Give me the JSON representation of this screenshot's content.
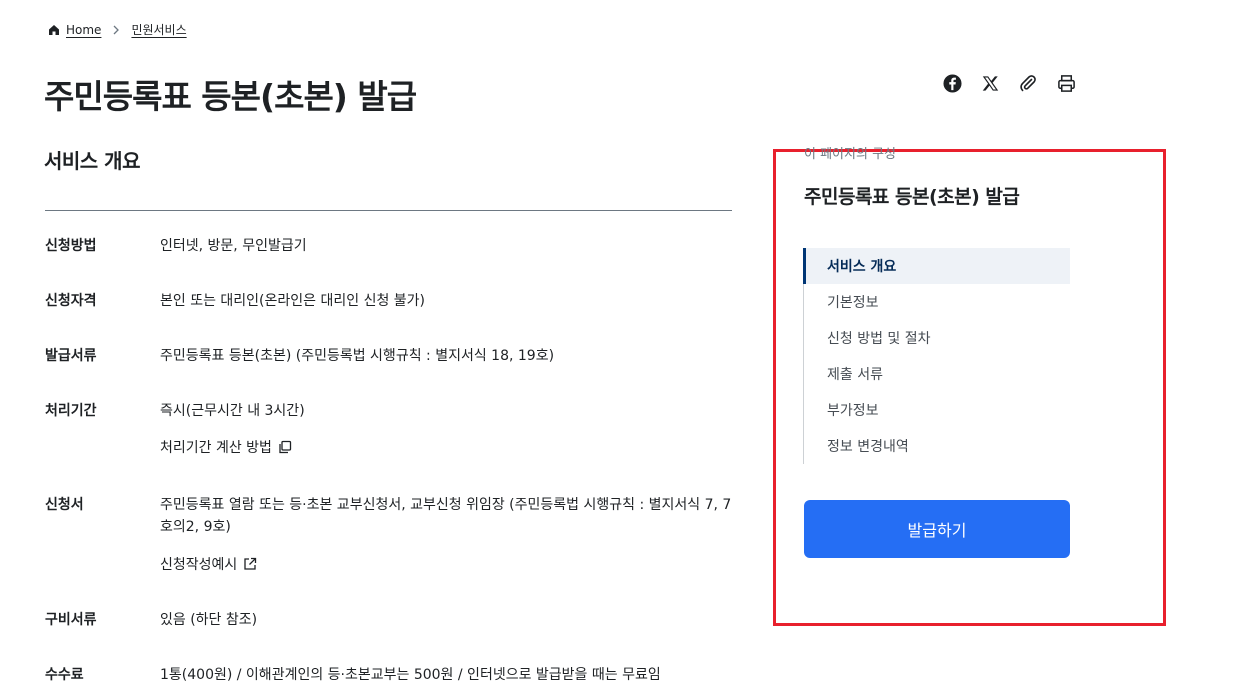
{
  "breadcrumb": {
    "home": "Home",
    "current": "민원서비스"
  },
  "page": {
    "title": "주민등록표 등본(초본) 발급"
  },
  "share": {
    "icons": [
      "facebook-icon",
      "x-icon",
      "link-clip-icon",
      "print-icon"
    ]
  },
  "overview": {
    "title": "서비스 개요",
    "rows": [
      {
        "label": "신청방법",
        "value": "인터넷, 방문, 무인발급기"
      },
      {
        "label": "신청자격",
        "value": "본인 또는 대리인(온라인은 대리인 신청 불가)"
      },
      {
        "label": "발급서류",
        "value": "주민등록표 등본(초본) (주민등록법 시행규칙 : 별지서식 18, 19호)"
      },
      {
        "label": "처리기간",
        "value": "즉시(근무시간 내 3시간)",
        "link": "처리기간 계산 방법"
      },
      {
        "label": "신청서",
        "value": "주민등록표 열람 또는 등·초본 교부신청서, 교부신청 위임장 (주민등록법 시행규칙 : 별지서식 7, 7호의2, 9호)",
        "link": "신청작성예시"
      },
      {
        "label": "구비서류",
        "value": "있음 (하단 참조)"
      },
      {
        "label": "수수료",
        "value": "1통(400원) / 이해관계인의 등·초본교부는 500원 / 인터넷으로 발급받을 때는 무료임"
      }
    ]
  },
  "toc": {
    "caption": "이 페이지의 구성",
    "title": "주민등록표 등본(초본) 발급",
    "items": [
      {
        "label": "서비스 개요",
        "active": true
      },
      {
        "label": "기본정보"
      },
      {
        "label": "신청 방법 및 절차"
      },
      {
        "label": "제출 서류"
      },
      {
        "label": "부가정보"
      },
      {
        "label": "정보 변경내역"
      }
    ],
    "button": "발급하기"
  },
  "colors": {
    "primary": "#256ef4",
    "highlight_border": "#e8202d",
    "active_bar": "#003675"
  }
}
